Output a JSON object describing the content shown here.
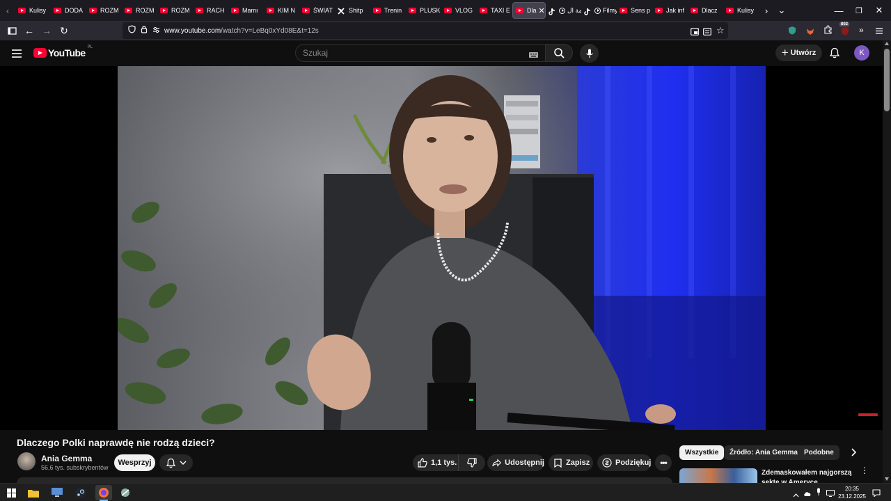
{
  "browser": {
    "tabs": [
      {
        "label": "Kulisy",
        "icon": "youtube-icon"
      },
      {
        "label": "DODA",
        "icon": "youtube-icon"
      },
      {
        "label": "ROZM",
        "icon": "youtube-icon"
      },
      {
        "label": "ROZM",
        "icon": "youtube-icon"
      },
      {
        "label": "ROZM",
        "icon": "youtube-icon"
      },
      {
        "label": "RACH",
        "icon": "youtube-icon"
      },
      {
        "label": "Mamı",
        "icon": "youtube-icon"
      },
      {
        "label": "KIM N",
        "icon": "youtube-icon"
      },
      {
        "label": "ŚWIAT",
        "icon": "youtube-icon"
      },
      {
        "label": "Shitp",
        "icon": "x-icon"
      },
      {
        "label": "Trenin",
        "icon": "youtube-icon"
      },
      {
        "label": "PLUSK",
        "icon": "youtube-icon"
      },
      {
        "label": "VLOG",
        "icon": "youtube-icon"
      },
      {
        "label": "TAXI E",
        "icon": "youtube-icon"
      },
      {
        "label": "Dla",
        "icon": "youtube-icon",
        "active": true
      },
      {
        "label": "لقمة ال",
        "icon": "tiktok-icon"
      },
      {
        "label": "Filmy",
        "icon": "tiktok-icon"
      },
      {
        "label": "Sens p",
        "icon": "youtube-icon"
      },
      {
        "label": "Jak inf",
        "icon": "youtube-icon"
      },
      {
        "label": "Dlacz",
        "icon": "youtube-icon"
      },
      {
        "label": "Kulisy",
        "icon": "youtube-icon"
      }
    ],
    "url_host": "www.youtube.com",
    "url_path": "/watch?v=LeBq0xYd08E&t=12s",
    "ext_badge": "802"
  },
  "youtube": {
    "logo_text": "YouTube",
    "logo_region": "PL",
    "search_placeholder": "Szukaj",
    "create_label": "Utwórz",
    "avatar_letter": "K",
    "brand_color": "#ff0033"
  },
  "video": {
    "title": "Dlaczego Polki naprawdę nie rodzą dzieci?",
    "channel_name": "Ania Gemma",
    "channel_subs": "56,6 tys. subskrybentów",
    "support_label": "Wesprzyj",
    "likes": "1,1 tys.",
    "share_label": "Udostępnij",
    "save_label": "Zapisz",
    "thanks_label": "Podziękuj"
  },
  "sidebar": {
    "chips": [
      "Wszystkie",
      "Źródło: Ania Gemma",
      "Podobne"
    ],
    "related_title": "Zdemaskowałem najgorszą sektę w Ameryce"
  },
  "taskbar": {
    "time": "20:35",
    "date": "23.12.2025"
  }
}
